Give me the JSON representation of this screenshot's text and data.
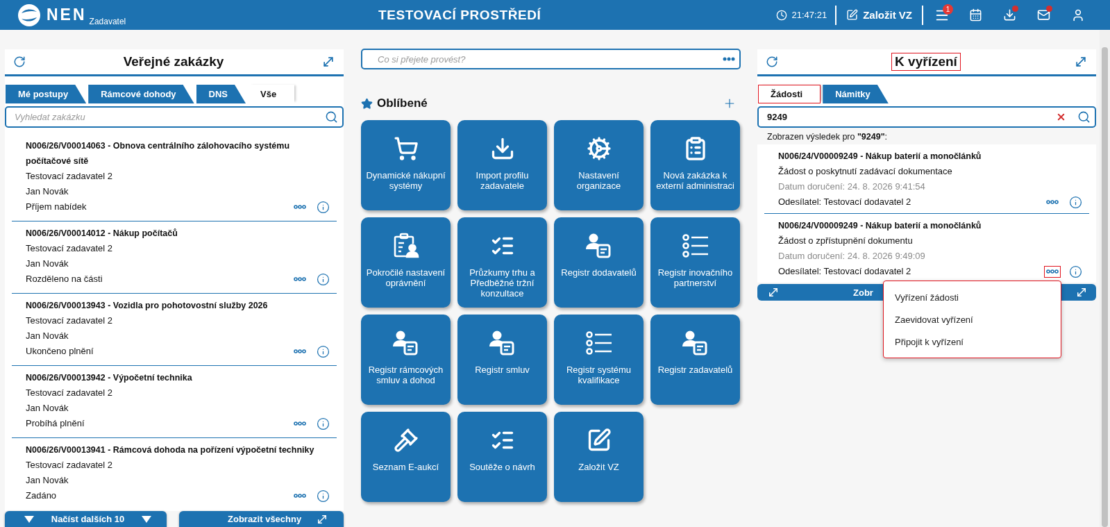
{
  "header": {
    "logo": "NEN",
    "logo_subtitle": "Zadavatel",
    "title": "TESTOVACÍ PROSTŘEDÍ",
    "time": "21:47:21",
    "create_button": "Založit VZ",
    "menu_badge": "1",
    "downloads_notification": true,
    "mail_notification": true
  },
  "left_panel": {
    "title": "Veřejné zakázky",
    "tabs": [
      {
        "label": "Mé postupy",
        "selected": false
      },
      {
        "label": "Rámcové dohody",
        "selected": false
      },
      {
        "label": "DNS",
        "selected": false
      },
      {
        "label": "Vše",
        "selected": true
      }
    ],
    "search": {
      "placeholder": "Vyhledat zakázku"
    },
    "items": [
      {
        "title": "N006/26/V00014063 - Obnova centrálního zálohovacího systému počítačové sítě",
        "buyer": "Testovací zadavatel 2",
        "person": "Jan Novák",
        "status": "Příjem nabídek"
      },
      {
        "title": "N006/26/V00014012 - Nákup počítačů",
        "buyer": "Testovací zadavatel 2",
        "person": "Jan Novák",
        "status": "Rozděleno na části"
      },
      {
        "title": "N006/26/V00013943 - Vozidla pro pohotovostní služby 2026",
        "buyer": "Testovací zadavatel 2",
        "person": "Jan Novák",
        "status": "Ukončeno plnění"
      },
      {
        "title": "N006/26/V00013942 - Výpočetní technika",
        "buyer": "Testovací zadavatel 2",
        "person": "Jan Novák",
        "status": "Probíhá plnění"
      },
      {
        "title": "N006/26/V00013941 - Rámcová dohoda na pořízení výpočetní techniky",
        "buyer": "Testovací zadavatel 2",
        "person": "Jan Novák",
        "status": "Zadáno"
      }
    ],
    "load_more_button": "Načíst dalších 10",
    "show_all_button": "Zobrazit všechny"
  },
  "center": {
    "command_field": {
      "placeholder": "Co si přejete provést?"
    },
    "favorites": {
      "title": "Oblíbené",
      "tiles": [
        {
          "kind": "cart",
          "label": "Dynamické nákupní systémy"
        },
        {
          "kind": "import",
          "label": "Import profilu zadavatele"
        },
        {
          "kind": "organization",
          "label": "Nastavení organizace"
        },
        {
          "kind": "clipboard-share",
          "label": "Nová zakázka k externí administraci"
        },
        {
          "kind": "clipboard-person",
          "label": "Pokročilé nastavení oprávnění"
        },
        {
          "kind": "checklist",
          "label": "Průzkumy trhu a Předběžné tržní konzultace"
        },
        {
          "kind": "person-document",
          "label": "Registr dodavatelů"
        },
        {
          "kind": "circle-list",
          "label": "Registr inovačního partnerství"
        },
        {
          "kind": "person-document",
          "label": "Registr rámcových smluv a dohod"
        },
        {
          "kind": "person-document",
          "label": "Registr smluv"
        },
        {
          "kind": "circle-list",
          "label": "Registr systému kvalifikace"
        },
        {
          "kind": "person-document",
          "label": "Registr zadavatelů"
        },
        {
          "kind": "gavel",
          "label": "Seznam E-aukcí"
        },
        {
          "kind": "checklist",
          "label": "Soutěže o návrh"
        },
        {
          "kind": "edit",
          "label": "Založit VZ"
        }
      ]
    }
  },
  "right_panel": {
    "title": "K vyřízení",
    "title_highlighted": true,
    "tabs": [
      {
        "label": "Žádosti",
        "selected": true,
        "highlighted": true
      },
      {
        "label": "Námitky",
        "selected": false,
        "highlighted": false
      }
    ],
    "search": {
      "value": "9249"
    },
    "result_text": "Zobrazen výsledek pro **\"9249\"**:",
    "items": [
      {
        "title": "N006/24/V00009249 - Nákup baterií a monočlánků",
        "request": "Žádost o poskytnutí zadávací dokumentace",
        "date": "Datum doručení: 24. 8. 2026 9:41:54",
        "sender": "Odesílatel: Testovací dodavatel 2",
        "menu_open": false
      },
      {
        "title": "N006/24/V00009249 - Nákup baterií a monočlánků",
        "request": "Žádost o zpřístupnění dokumentu",
        "date": "Datum doručení: 24. 8. 2026 9:49:09",
        "sender": "Odesílatel: Testovací dodavatel 2",
        "menu_open": true
      }
    ],
    "show_all_button": "Zobr",
    "menu": {
      "highlighted": true,
      "items": [
        "Vyřízení žádosti",
        "Zaevidovat vyřízení",
        "Připojit k vyřízení"
      ]
    }
  }
}
